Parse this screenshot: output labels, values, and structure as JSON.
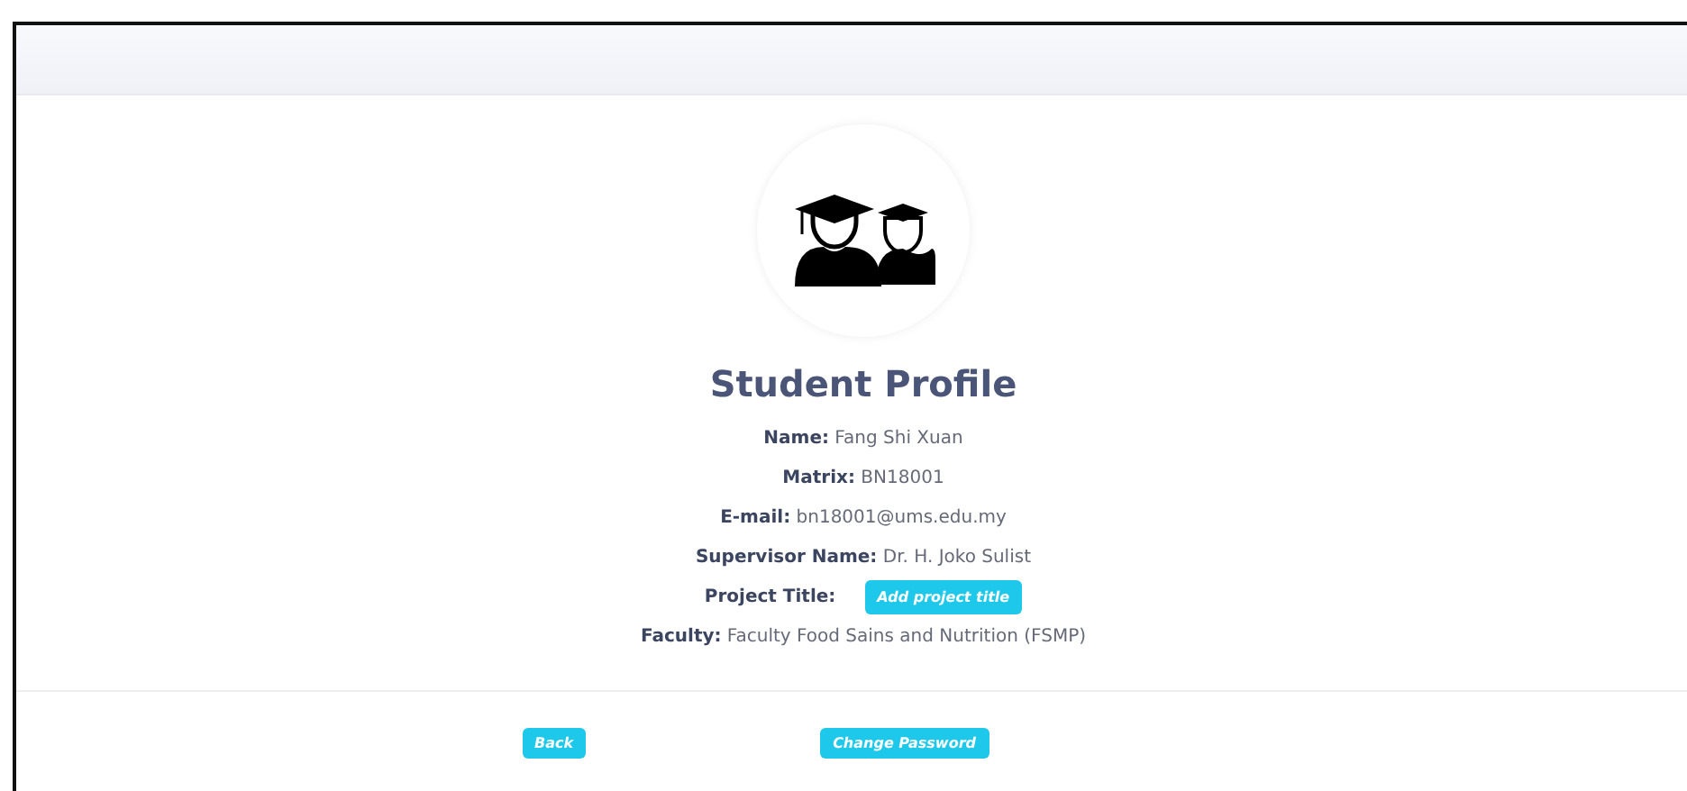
{
  "title": "Student Profile",
  "fields": [
    {
      "kind": "text",
      "label": "Name:",
      "value": "Fang Shi Xuan"
    },
    {
      "kind": "text",
      "label": "Matrix:",
      "value": "BN18001"
    },
    {
      "kind": "text",
      "label": "E-mail:",
      "value": "bn18001@ums.edu.my"
    },
    {
      "kind": "text",
      "label": "Supervisor Name:",
      "value": "Dr. H. Joko Sulist"
    },
    {
      "kind": "button",
      "label": "Project Title:",
      "value": "Add project title"
    },
    {
      "kind": "text",
      "label": "Faculty:",
      "value": "Faculty Food Sains and Nutrition (FSMP)"
    }
  ],
  "buttons": [
    "Back",
    "Change Password"
  ]
}
